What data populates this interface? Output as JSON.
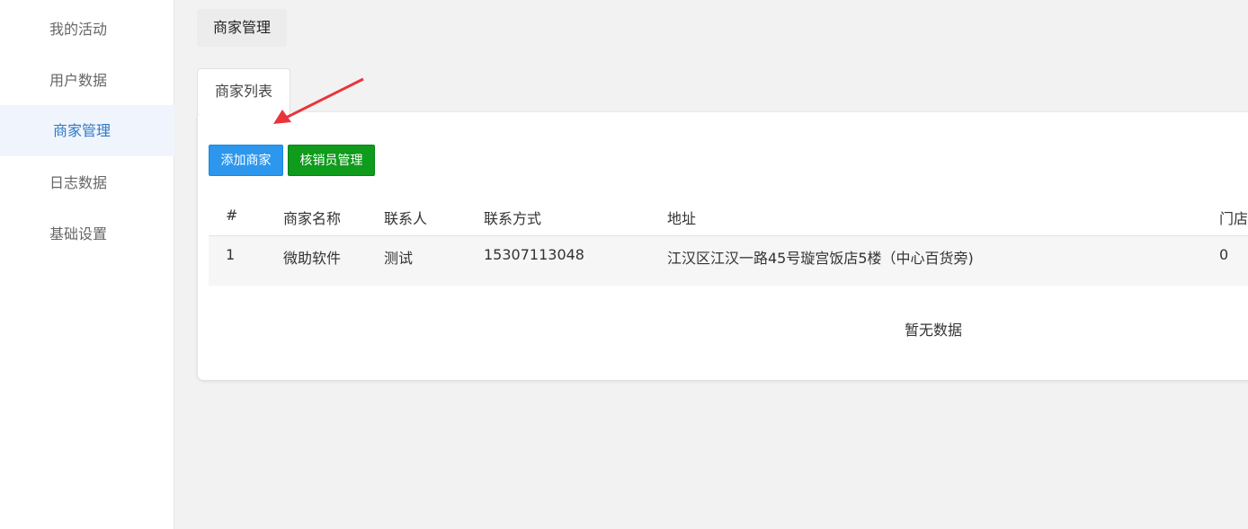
{
  "sidebar": {
    "items": [
      {
        "label": "我的活动"
      },
      {
        "label": "用户数据"
      },
      {
        "label": "商家管理"
      },
      {
        "label": "日志数据"
      },
      {
        "label": "基础设置"
      }
    ]
  },
  "breadcrumb": {
    "current": "商家管理"
  },
  "tabs": [
    {
      "label": "商家列表"
    }
  ],
  "toolbar": {
    "add_label": "添加商家",
    "verify_label": "核销员管理"
  },
  "table": {
    "headers": [
      "#",
      "商家名称",
      "联系人",
      "联系方式",
      "地址",
      "门店"
    ],
    "rows": [
      [
        "1",
        "微助软件",
        "测试",
        "15307113048",
        "江汉区江汉一路45号璇宫饭店5楼（中心百货旁)",
        "0"
      ]
    ]
  },
  "empty_text": "暂无数据",
  "colors": {
    "accent": "#2d97ee",
    "success": "#0f9b1c",
    "annotation": "#e8353b"
  }
}
